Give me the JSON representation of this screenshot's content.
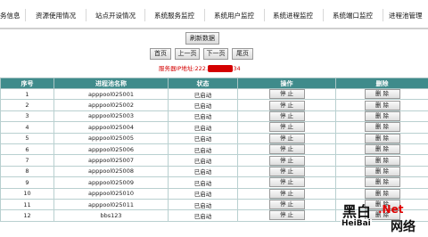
{
  "nav": {
    "items": [
      "务信息",
      "资源使用情况",
      "站点开设情况",
      "系统服务监控",
      "系统用户监控",
      "系统进程监控",
      "系统端口监控",
      "进程池管理"
    ]
  },
  "toolbar": {
    "refresh_label": "刷新数据",
    "first_label": "首页",
    "prev_label": "上一页",
    "next_label": "下一页",
    "last_label": "尾页"
  },
  "server": {
    "label": "服务器IP地址:",
    "ip_prefix": "222.",
    "ip_suffix": "34"
  },
  "table": {
    "headers": [
      "序号",
      "进程池名称",
      "状态",
      "操作",
      "删除"
    ],
    "stop_label": "停 止",
    "delete_label": "删 除",
    "rows": [
      {
        "no": "1",
        "name": "apppool025001",
        "status": "已启动"
      },
      {
        "no": "2",
        "name": "apppool025002",
        "status": "已启动"
      },
      {
        "no": "3",
        "name": "apppool025003",
        "status": "已启动"
      },
      {
        "no": "4",
        "name": "apppool025004",
        "status": "已启动"
      },
      {
        "no": "5",
        "name": "apppool025005",
        "status": "已启动"
      },
      {
        "no": "6",
        "name": "apppool025006",
        "status": "已启动"
      },
      {
        "no": "7",
        "name": "apppool025007",
        "status": "已启动"
      },
      {
        "no": "8",
        "name": "apppool025008",
        "status": "已启动"
      },
      {
        "no": "9",
        "name": "apppool025009",
        "status": "已启动"
      },
      {
        "no": "10",
        "name": "apppool025010",
        "status": "已启动"
      },
      {
        "no": "11",
        "name": "apppool025011",
        "status": "已启动"
      },
      {
        "no": "12",
        "name": "bbs123",
        "status": "已启动"
      }
    ]
  },
  "watermark": {
    "cn": "黑白",
    "net": ".Net",
    "en": "HeiBai",
    "cn2": "网络"
  }
}
